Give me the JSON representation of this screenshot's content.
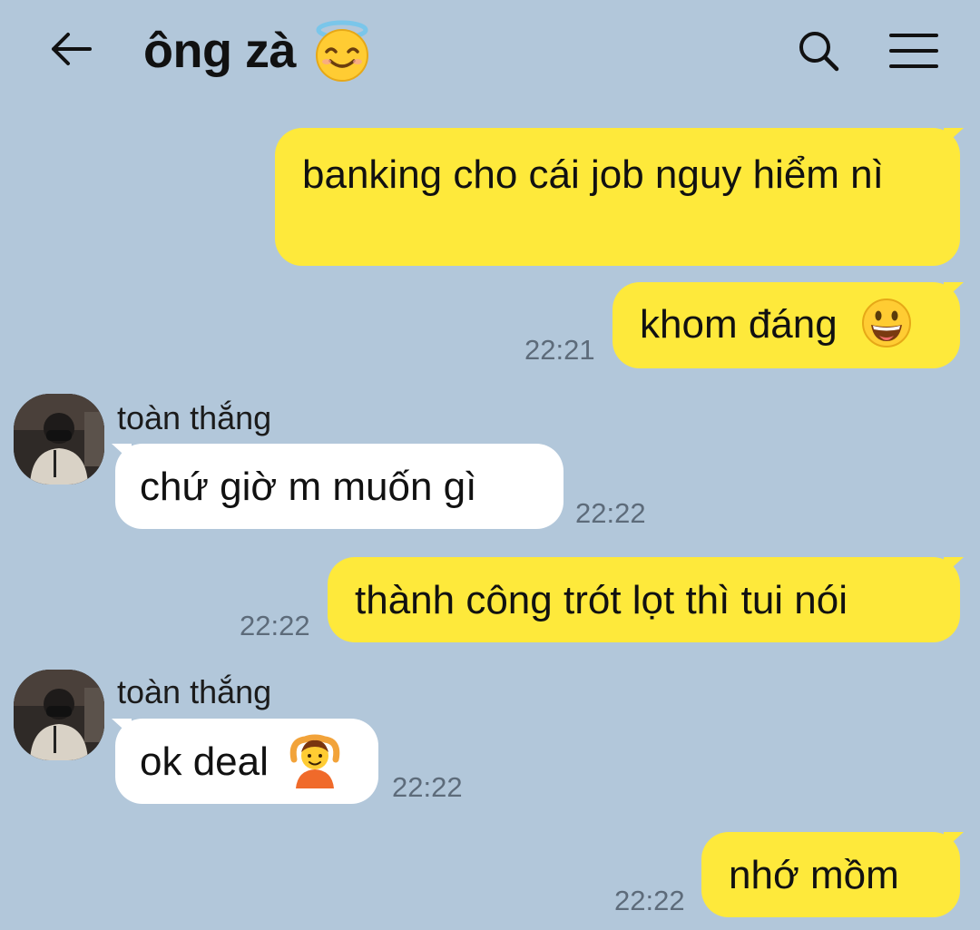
{
  "header": {
    "title": "ông zà",
    "title_emoji": "smiling-face-with-halo-icon",
    "back_icon": "back-arrow-icon",
    "search_icon": "search-icon",
    "menu_icon": "menu-icon"
  },
  "colors": {
    "background": "#b2c7da",
    "outgoing_bubble": "#fee93b",
    "incoming_bubble": "#ffffff",
    "time_text": "#5d6b7a"
  },
  "messages": [
    {
      "direction": "out",
      "text": "banking cho cái job nguy hiểm nì",
      "time": ""
    },
    {
      "direction": "out",
      "text": "khom đáng",
      "emoji": "grinning-face-icon",
      "time": "22:21"
    },
    {
      "direction": "in",
      "sender": "toàn thắng",
      "text": "chứ giờ m muốn gì",
      "time": "22:22"
    },
    {
      "direction": "out",
      "text": "thành công trót lọt thì tui nói",
      "time": "22:22"
    },
    {
      "direction": "in",
      "sender": "toàn thắng",
      "text": "ok deal",
      "emoji": "person-gesturing-ok-icon",
      "time": "22:22"
    },
    {
      "direction": "out",
      "text": "nhớ mồm",
      "time": "22:22"
    }
  ]
}
